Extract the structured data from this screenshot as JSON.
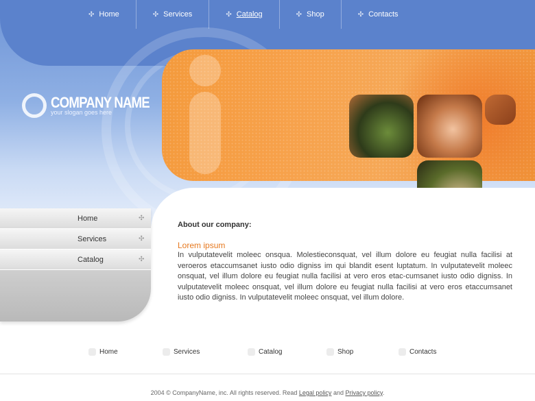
{
  "top_nav": {
    "items": [
      {
        "label": "Home",
        "active": false
      },
      {
        "label": "Services",
        "active": false
      },
      {
        "label": "Catalog",
        "active": true
      },
      {
        "label": "Shop",
        "active": false
      },
      {
        "label": "Contacts",
        "active": false
      }
    ],
    "bullet_icon": "crosshair-bullet-icon"
  },
  "logo": {
    "name": "COMPANY NAME",
    "slogan": "your slogan goes here",
    "icon": "ring-logo-icon"
  },
  "sidebar": {
    "items": [
      {
        "label": "Home"
      },
      {
        "label": "Services"
      },
      {
        "label": "Catalog"
      }
    ]
  },
  "content": {
    "heading": "About our company:",
    "subheading": "Lorem ipsum",
    "body": "In vulputatevelit moleec onsqua. Molestieconsquat, vel illum dolore eu feugiat nulla facilisi at veroeros etaccumsanet iusto odio digniss im qui blandit esent luptatum. In vulputatevelit moleec onsquat, vel illum dolore eu feugiat nulla facilisi at vero eros etac-cumsanet iusto odio digniss. In vulputatevelit moleec onsquat, vel illum dolore eu feugiat nulla facilisi at vero eros etaccumsanet iusto odio digniss. In vulputatevelit moleec onsquat, vel illum dolore."
  },
  "bottom_nav": {
    "items": [
      {
        "label": "Home"
      },
      {
        "label": "Services"
      },
      {
        "label": "Catalog"
      },
      {
        "label": "Shop"
      },
      {
        "label": "Contacts"
      }
    ]
  },
  "footer": {
    "prefix": "2004 © CompanyName, inc. All rights reserved. Read",
    "legal_link": "Legal policy",
    "and": "and",
    "privacy_link": "Privacy policy",
    "suffix": "."
  },
  "colors": {
    "top_blue": "#5b82cc",
    "accent_orange": "#f49a3c",
    "subheading_orange": "#e6781e"
  }
}
